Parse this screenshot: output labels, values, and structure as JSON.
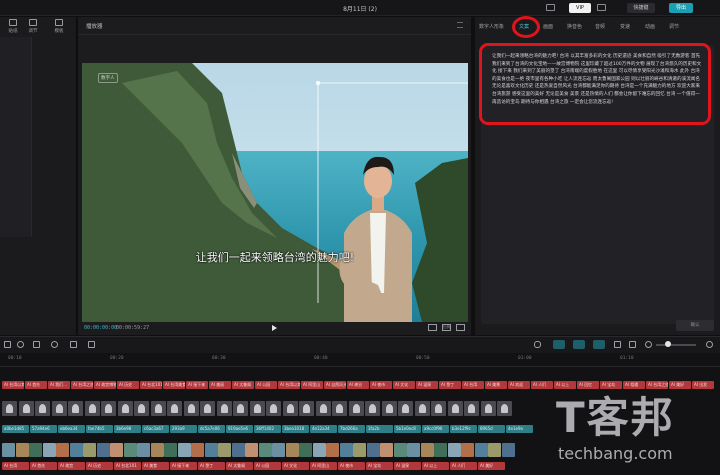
{
  "window": {
    "title": "8月11日 (2)",
    "badge_label": "VIP",
    "shortcut_label": "快捷键",
    "export_label": "导出"
  },
  "left_panel": {
    "tabs": [
      {
        "label": "贴纸",
        "icon": "sticker-icon"
      },
      {
        "label": "调节",
        "icon": "adjust-icon"
      },
      {
        "label": "模板",
        "icon": "template-icon"
      }
    ]
  },
  "player": {
    "title": "播放器",
    "subtitle": "让我们一起来领略台湾的魅力吧!",
    "watermark": "数字人",
    "current_time": "00:00:00:00",
    "total_time": "00:00:59:27",
    "ratio_label": "比例"
  },
  "right_panel": {
    "tabs": [
      {
        "label": "数字人形象",
        "active": false
      },
      {
        "label": "文案",
        "active": true
      },
      {
        "label": "画面",
        "active": false
      },
      {
        "label": "换音色",
        "active": false
      },
      {
        "label": "音频",
        "active": false
      },
      {
        "label": "变速",
        "active": false
      },
      {
        "label": "动画",
        "active": false
      },
      {
        "label": "调节",
        "active": false
      }
    ],
    "script_text": "让我们一起来领略台湾的魅力吧!  台湾 以其丰富多彩的文化 历史遗迹 美食和自然 吸引了无数游客 首先 我们来到了台湾的文化宝地——故宫博物院 这里珍藏了超过100万件的文物 展现了台湾悠久的历史和文化 接下来 我们来到了美丽的垦丁 台湾南端的度假胜地 在这里 可以尽情享受阳光沙滩和海水 此外 台湾的美食也是一绝 夜市里有各种小吃 让人流连忘返 而太鲁阁国家公园 则以壮丽的峡谷和清澈的溪流闻名 无论是喜欢文化历史 还是热爱自然风光 台湾都能满足你的期待 台湾是一个充满魅力的地方 欢迎大家来台湾旅游 感受这里的美好 无论是美食 美景 还是热情的人们 都会让你留下难忘的回忆 台湾 一个值得一再造访的宝岛 期待与你相遇 台湾之旅 一定会让您流连忘返!",
    "confirm_label": "确认"
  },
  "timeline": {
    "ruler_marks": [
      "00:10",
      "00:20",
      "00:30",
      "00:40",
      "00:50",
      "01:00",
      "01:10"
    ],
    "text_chips": [
      "AI 台湾以其...",
      "AI 首先",
      "AI 我们...",
      "AI 台湾之旅",
      "AI 故宫博物院",
      "AI 历史",
      "AI 台北101",
      "AI 台湾美食",
      "AI 接下来",
      "AI 美丽",
      "AI 太鲁阁",
      "AI 公园",
      "AI 台湾以其...",
      "AI 阿里山",
      "AI 自然风光",
      "AI 峡谷",
      "AI 夜市",
      "AI 文化",
      "AI 温泉",
      "AI 垦丁",
      "AI 台湾",
      "AI 美景",
      "AI 欢迎",
      "AI 人们",
      "AI 以上",
      "AI 回忆",
      "AI 宝岛",
      "AI 相遇",
      "AI 台湾之旅",
      "AI 美好",
      "AI 出发"
    ],
    "clip_ids": [
      "a0be1d85",
      "57a94e6",
      "eb6ea34",
      "fae74b5",
      "3b6e98",
      "c6ac3a67",
      "293a9",
      "dc5a7e06",
      "919ae5e6",
      "36ff1402",
      "3bea1018",
      "4e12a34",
      "7bd266a",
      "3fa2b",
      "5b1e0ec8",
      "a9cc0f96",
      "b3e12f9c",
      "8965d",
      "4e1e9a"
    ],
    "bottom_chips": [
      "AI 台湾",
      "AI 首先",
      "AI 故宫",
      "AI 历史",
      "AI 台北101",
      "AI 美食",
      "AI 接下来",
      "AI 垦丁",
      "AI 太鲁阁",
      "AI 公园",
      "AI 文化",
      "AI 阿里山",
      "AI 夜市",
      "AI 宝岛",
      "AI 温泉",
      "AI 以上",
      "AI 人们",
      "AI 美好"
    ]
  },
  "brand": {
    "cn": "T客邦",
    "en": "techbang.com"
  },
  "colors": {
    "accent": "#46c2d6",
    "highlight": "#e0141d",
    "text_chip": "#b3383c",
    "avatar_track": "#2e7e88"
  }
}
